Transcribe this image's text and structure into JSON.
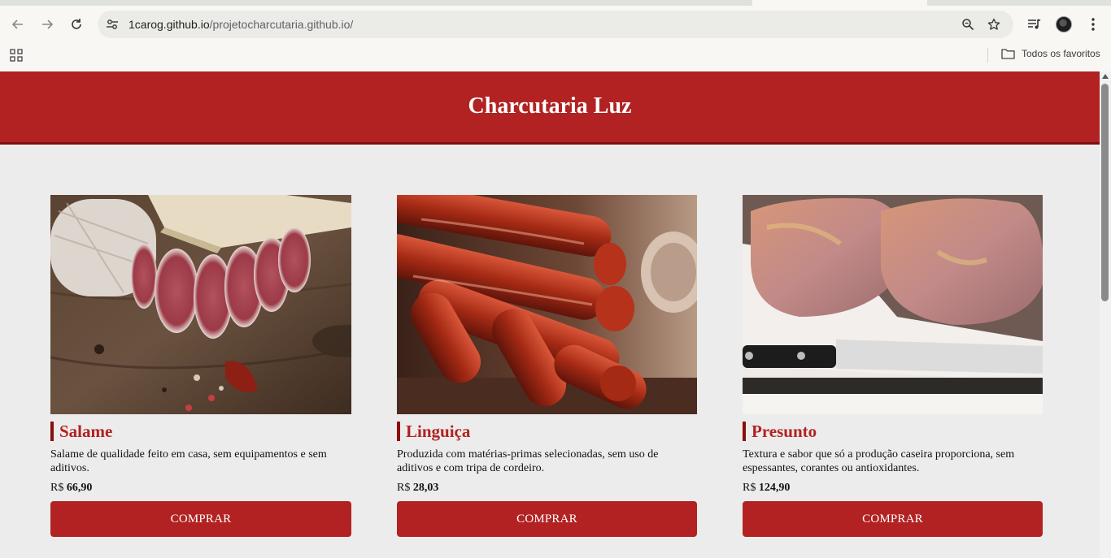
{
  "browser": {
    "url_host": "1carog.github.io",
    "url_path": "/projetocharcutaria.github.io/",
    "bookmarks_folder": "Todos os favoritos"
  },
  "site": {
    "title": "Charcutaria Luz"
  },
  "colors": {
    "brand": "#b22222",
    "brand_dark": "#7e0f0f",
    "page_bg": "#ececec"
  },
  "products": [
    {
      "name": "Salame",
      "description": "Salame de qualidade feito em casa, sem equipamentos e sem aditivos.",
      "currency": "R$",
      "price": "66,90",
      "button": "COMPRAR",
      "image": "salame-photo"
    },
    {
      "name": "Linguiça",
      "description": "Produzida com matérias-primas selecionadas, sem uso de aditivos e com tripa de cordeiro.",
      "currency": "R$",
      "price": "28,03",
      "button": "COMPRAR",
      "image": "linguica-photo"
    },
    {
      "name": "Presunto",
      "description": "Textura e sabor que só a produção caseira proporciona, sem espessantes, corantes ou antioxidantes.",
      "currency": "R$",
      "price": "124,90",
      "button": "COMPRAR",
      "image": "presunto-photo"
    }
  ]
}
